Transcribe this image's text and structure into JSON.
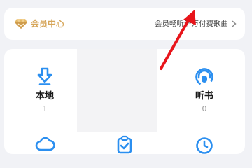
{
  "vip": {
    "title": "会员中心",
    "promo": "会员畅听千万付费歌曲"
  },
  "tiles": [
    {
      "label": "本地",
      "count": "1",
      "icon": "download-icon"
    },
    {
      "label": "听书",
      "count": "0",
      "icon": "headphones-icon"
    },
    {
      "label": "",
      "count": "",
      "icon": "cloud-icon"
    },
    {
      "label": "",
      "count": "",
      "icon": "purchased-icon"
    },
    {
      "label": "",
      "count": "",
      "icon": "history-clock-icon"
    }
  ],
  "colors": {
    "gold": "#d6a65a",
    "accent_blue": "#2b8ff0",
    "annotation_red": "#e8141a",
    "page_bg": "#f1f2f6"
  }
}
